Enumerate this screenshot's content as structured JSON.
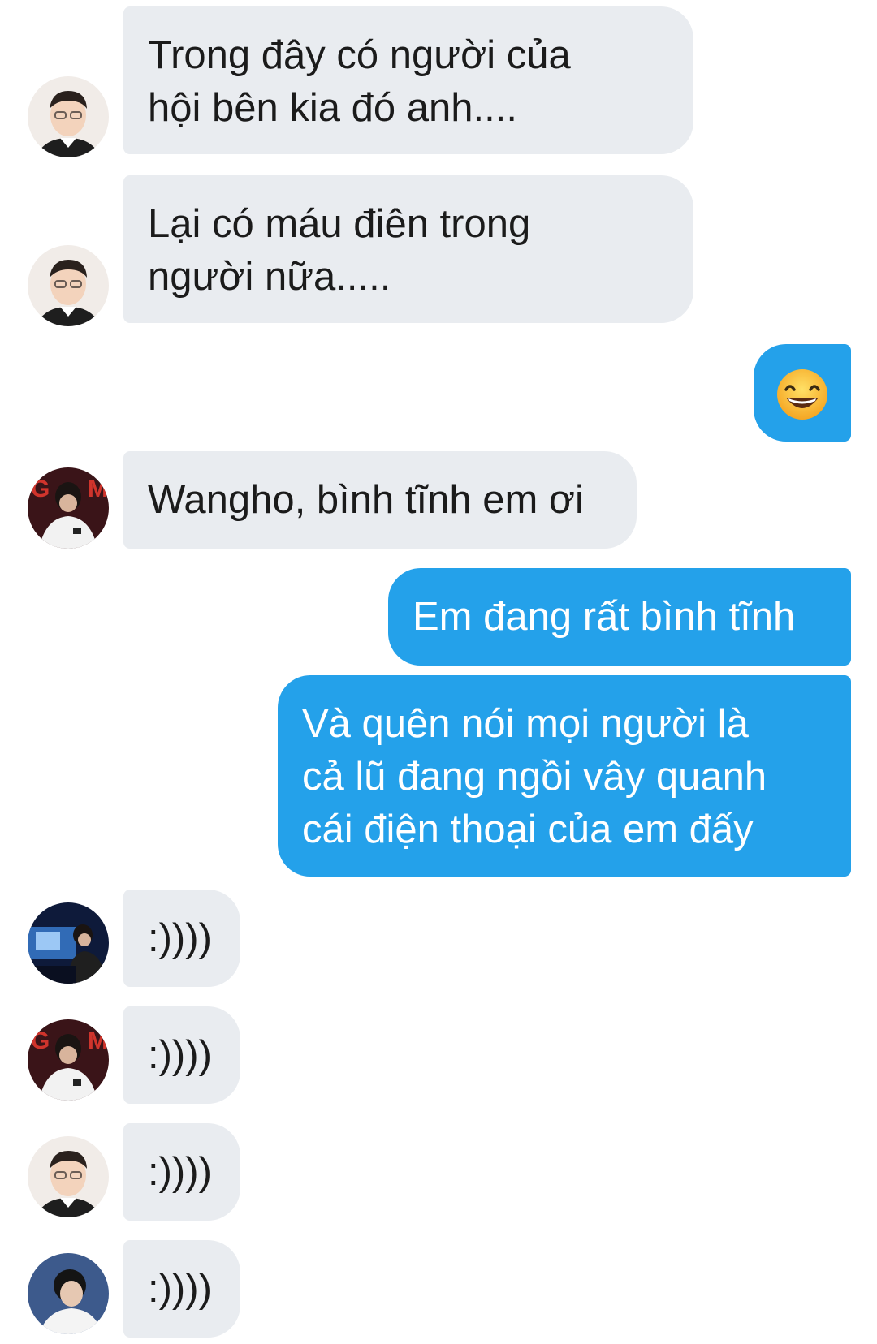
{
  "messages": [
    {
      "from": "friend-glasses",
      "lines": [
        "Trong đây có người của",
        "hội bên kia đó anh...."
      ]
    },
    {
      "from": "friend-glasses",
      "lines": [
        "Lại có máu điên trong",
        "người nữa....."
      ]
    },
    {
      "from": "me",
      "emoji": "grinning-face-emoji"
    },
    {
      "from": "friend-gm",
      "lines": [
        "Wangho, bình tĩnh em ơi"
      ]
    },
    {
      "from": "me",
      "lines": [
        "Em đang rất bình tĩnh"
      ]
    },
    {
      "from": "me",
      "lines": [
        "Và quên nói mọi người là",
        "cả lũ đang ngồi vây quanh",
        "cái điện thoại của em đấy"
      ]
    },
    {
      "from": "friend-stage",
      "lines": [
        ":))))"
      ]
    },
    {
      "from": "friend-gm",
      "lines": [
        ":))))"
      ]
    },
    {
      "from": "friend-glasses",
      "lines": [
        ":))))"
      ]
    },
    {
      "from": "friend-blue",
      "lines": [
        ":))))"
      ]
    }
  ],
  "colors": {
    "incoming_bubble": "#e9ecf0",
    "outgoing_bubble": "#24a1ea",
    "incoming_text": "#1b1b1b",
    "outgoing_text": "#ffffff"
  }
}
